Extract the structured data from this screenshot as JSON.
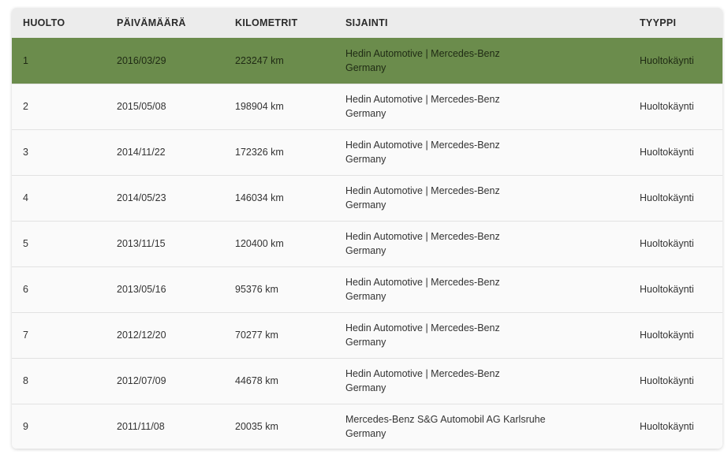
{
  "table": {
    "headers": [
      "HUOLTO",
      "PÄIVÄMÄÄRÄ",
      "KILOMETRIT",
      "SIJAINTI",
      "TYYPPI"
    ],
    "rows": [
      {
        "num": "1",
        "date": "2016/03/29",
        "km": "223247 km",
        "location": [
          "Hedin Automotive | Mercedes-Benz",
          "Germany"
        ],
        "type": "Huoltokäynti"
      },
      {
        "num": "2",
        "date": "2015/05/08",
        "km": "198904 km",
        "location": [
          "Hedin Automotive | Mercedes-Benz",
          "Germany"
        ],
        "type": "Huoltokäynti"
      },
      {
        "num": "3",
        "date": "2014/11/22",
        "km": "172326 km",
        "location": [
          "Hedin Automotive | Mercedes-Benz",
          "Germany"
        ],
        "type": "Huoltokäynti"
      },
      {
        "num": "4",
        "date": "2014/05/23",
        "km": "146034 km",
        "location": [
          "Hedin Automotive | Mercedes-Benz",
          "Germany"
        ],
        "type": "Huoltokäynti"
      },
      {
        "num": "5",
        "date": "2013/11/15",
        "km": "120400 km",
        "location": [
          "Hedin Automotive | Mercedes-Benz",
          "Germany"
        ],
        "type": "Huoltokäynti"
      },
      {
        "num": "6",
        "date": "2013/05/16",
        "km": "95376 km",
        "location": [
          "Hedin Automotive | Mercedes-Benz",
          "Germany"
        ],
        "type": "Huoltokäynti"
      },
      {
        "num": "7",
        "date": "2012/12/20",
        "km": "70277 km",
        "location": [
          "Hedin Automotive | Mercedes-Benz",
          "Germany"
        ],
        "type": "Huoltokäynti"
      },
      {
        "num": "8",
        "date": "2012/07/09",
        "km": "44678 km",
        "location": [
          "Hedin Automotive | Mercedes-Benz",
          "Germany"
        ],
        "type": "Huoltokäynti"
      },
      {
        "num": "9",
        "date": "2011/11/08",
        "km": "20035 km",
        "location": [
          "Mercedes-Benz S&G Automobil AG Karlsruhe",
          "Germany"
        ],
        "type": "Huoltokäynti"
      }
    ]
  },
  "colors": {
    "selected_row": "#6b8c4c",
    "header_bg": "#ececec",
    "row_bg": "#fafafa"
  }
}
